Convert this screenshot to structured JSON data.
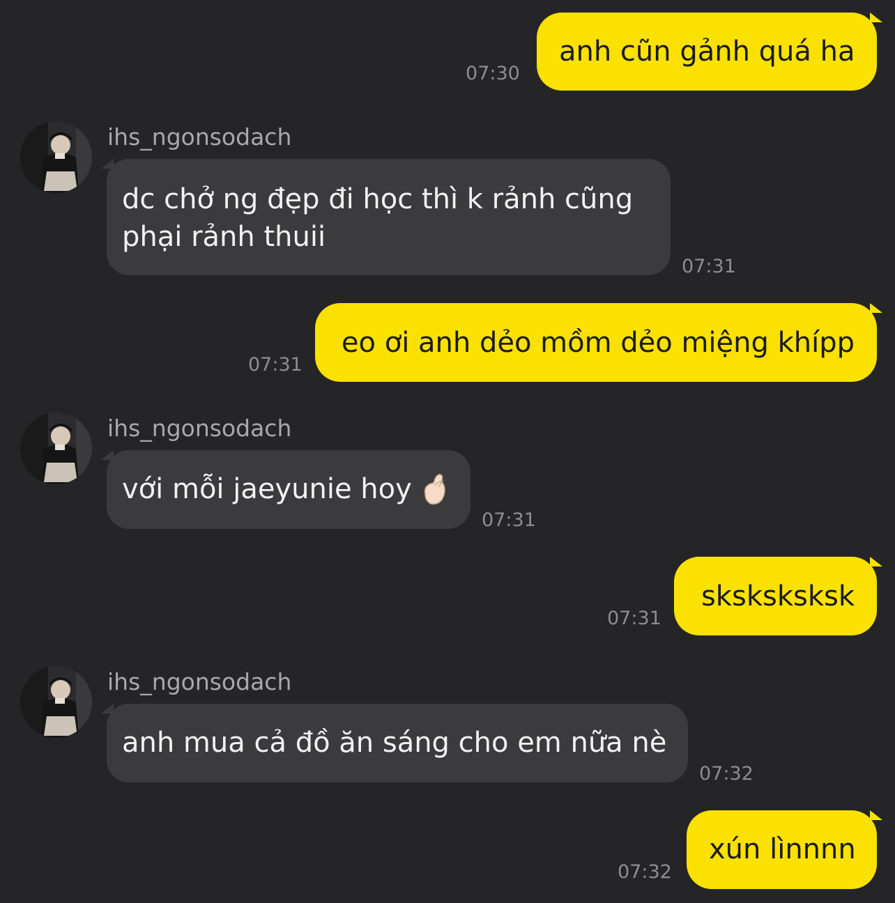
{
  "conversation": {
    "messages": [
      {
        "direction": "out",
        "text": "anh cũn gảnh quá ha",
        "time": "07:30"
      },
      {
        "direction": "in",
        "sender": "ihs_ngonsodach",
        "text": "dc chở ng đẹp đi học thì k rảnh cũng phại rảnh thuii",
        "time": "07:31"
      },
      {
        "direction": "out",
        "text": "eo ơi anh dẻo mồm dẻo miệng khípp",
        "time": "07:31"
      },
      {
        "direction": "in",
        "sender": "ihs_ngonsodach",
        "text": "với mỗi jaeyunie hoy",
        "emoji": "finger-heart-emoji",
        "time": "07:31"
      },
      {
        "direction": "out",
        "text": "sksksksksk",
        "time": "07:31"
      },
      {
        "direction": "in",
        "sender": "ihs_ngonsodach",
        "text": "anh mua cả đồ ăn sáng cho em nữa nè",
        "time": "07:32"
      },
      {
        "direction": "out",
        "text": "xún lìnnnn",
        "time": "07:32"
      }
    ]
  },
  "colors": {
    "background": "#252527",
    "outgoing_bubble": "#fae100",
    "incoming_bubble": "#3b3b3d",
    "timestamp": "#8e8e90",
    "sender_name": "#a9a9ab"
  }
}
